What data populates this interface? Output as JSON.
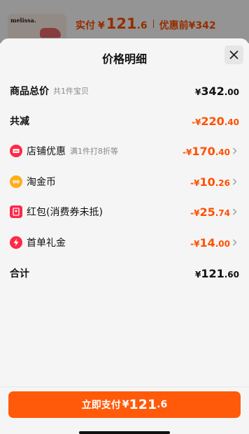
{
  "background": {
    "thumbnail_brand": "melissa.",
    "paid_label": "实付",
    "currency": "¥",
    "paid_int": "121",
    "paid_dec": ".6",
    "before_discount_label": "优惠前",
    "before_discount_value": "¥342"
  },
  "sheet": {
    "title": "价格明细",
    "close_icon": "close-icon"
  },
  "rows": {
    "total": {
      "label": "商品总价",
      "sub": "共1件宝贝",
      "currency": "¥",
      "int": "342",
      "dec": ".00"
    },
    "reduced": {
      "label": "共减",
      "currency": "-¥",
      "int": "220",
      "dec": ".40"
    },
    "store": {
      "label": "店铺优惠",
      "sub": "满1件打8折等",
      "currency": "-¥",
      "int": "170",
      "dec": ".40",
      "icon": "store-coupon-icon"
    },
    "taojinbi": {
      "label": "淘金币",
      "currency": "-¥",
      "int": "10",
      "dec": ".26",
      "icon": "taojinbi-icon"
    },
    "redpacket": {
      "label": "红包(消费券未抵)",
      "currency": "-¥",
      "int": "25",
      "dec": ".74",
      "icon": "red-packet-icon"
    },
    "firstorder": {
      "label": "首单礼金",
      "currency": "-¥",
      "int": "14",
      "dec": ".00",
      "icon": "lightning-icon"
    },
    "sum": {
      "label": "合计",
      "currency": "¥",
      "int": "121",
      "dec": ".60"
    }
  },
  "pay_button": {
    "label": "立即支付",
    "currency": "¥",
    "int": "121",
    "dec": ".6"
  },
  "colors": {
    "accent": "#ff5000",
    "button": "#ff5a0a",
    "sheet_bg": "#f5f5f5"
  }
}
